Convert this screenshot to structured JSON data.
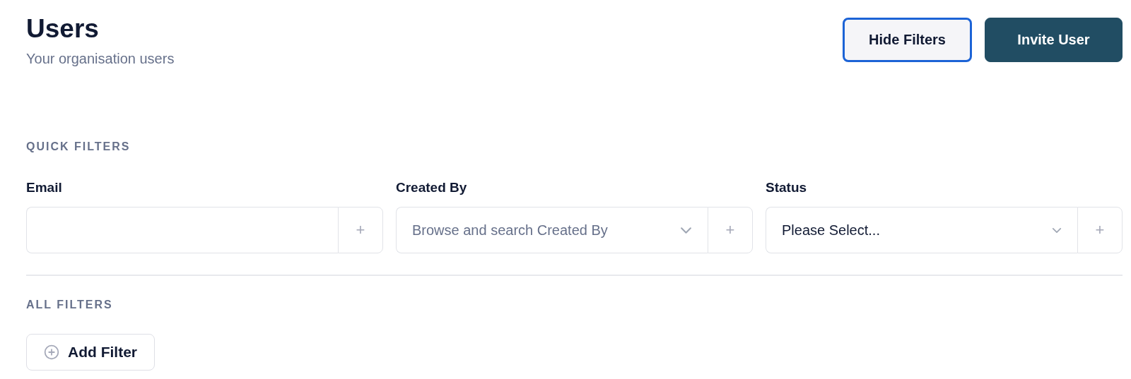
{
  "header": {
    "title": "Users",
    "subtitle": "Your organisation users"
  },
  "actions": [
    {
      "label": "Hide Filters",
      "kind": "secondary",
      "focused": true
    },
    {
      "label": "Invite User",
      "kind": "primary",
      "focused": false
    }
  ],
  "quick_filters": {
    "heading": "QUICK FILTERS",
    "filters": [
      {
        "label": "Email",
        "kind": "text",
        "add": "+"
      },
      {
        "label": "Created By",
        "kind": "search-select",
        "placeholder": "Browse and search Created By",
        "add": "+"
      },
      {
        "label": "Status",
        "kind": "select",
        "value": "Please Select...",
        "add": "+"
      }
    ]
  },
  "all_filters": {
    "heading": "ALL FILTERS",
    "button": "Add Filter"
  }
}
